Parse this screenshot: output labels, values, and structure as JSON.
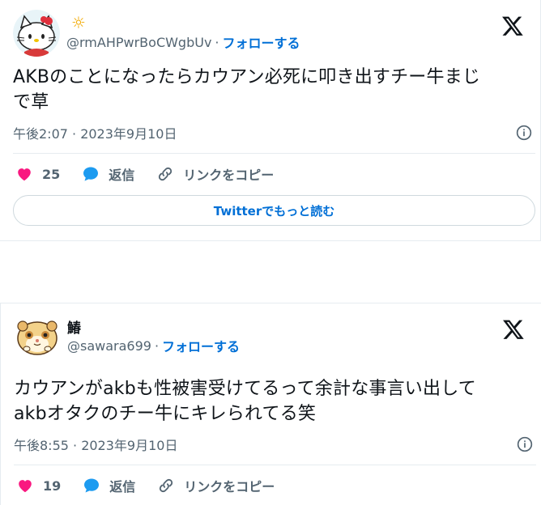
{
  "tweets": [
    {
      "display_name": "",
      "name_emoji": "☼",
      "handle": "@rmAHPwrBoCWgbUv",
      "separator": "·",
      "follow_label": "フォローする",
      "text_line1": "AKBのことになったらカウアン必死に叩き出すチー牛まじ",
      "text_line2": "で草",
      "timestamp": "午後2:07 · 2023年9月10日",
      "likes": "25",
      "reply_label": "返信",
      "copy_link_label": "リンクをコピー",
      "read_more_label": "Twitterでもっと読む",
      "avatar": "hello-kitty-avatar"
    },
    {
      "display_name": "鰆",
      "handle": "@sawara699",
      "separator": "·",
      "follow_label": "フォローする",
      "text_line1": "カウアンがakbも性被害受けてるって余計な事言い出して",
      "text_line2": "akbオタクのチー牛にキレられてる笑",
      "timestamp": "午後8:55 · 2023年9月10日",
      "likes": "19",
      "reply_label": "返信",
      "copy_link_label": "リンクをコピー",
      "avatar": "hamster-avatar"
    }
  ],
  "icons": {
    "like": "heart-icon",
    "reply": "speech-bubble-icon",
    "copy": "link-icon",
    "info": "info-icon",
    "brand": "x-logo-icon"
  },
  "colors": {
    "like": "#f91880",
    "reply": "#1d9bf0",
    "link": "#006fd6",
    "muted": "#536471"
  }
}
